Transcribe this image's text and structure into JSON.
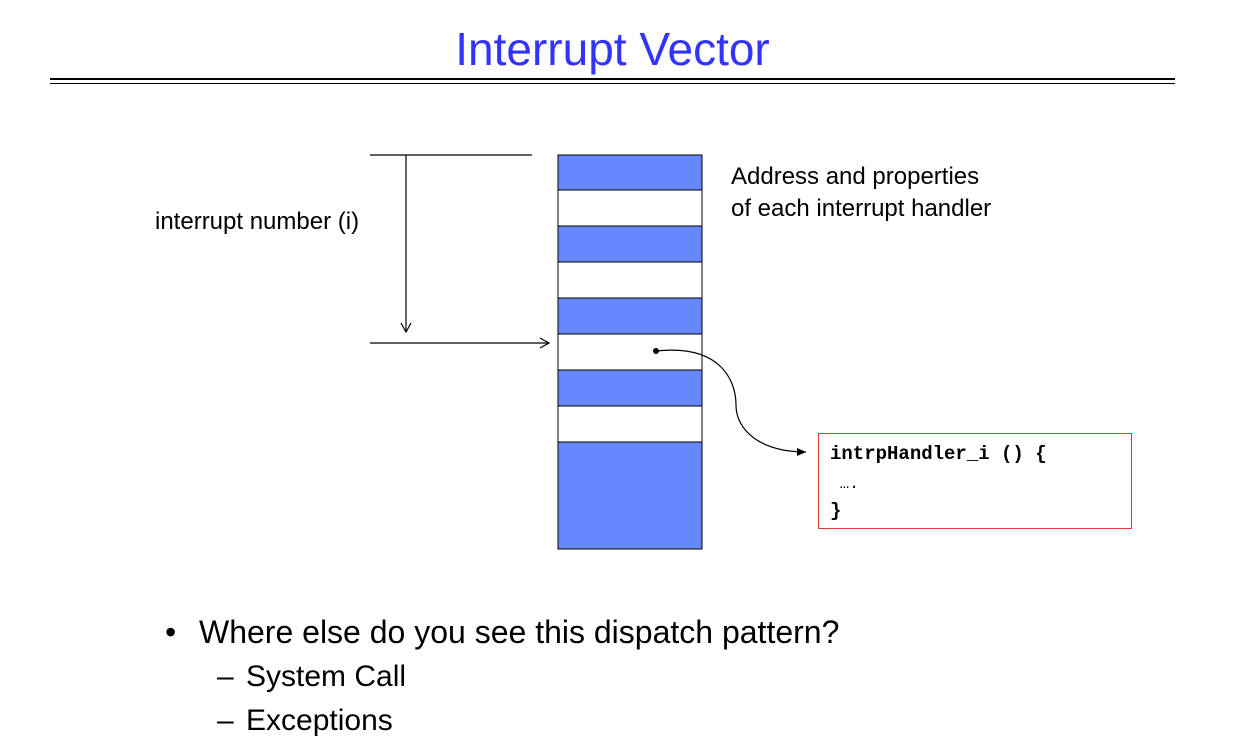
{
  "slide": {
    "title": "Interrupt Vector"
  },
  "diagram": {
    "interrupt_label": "interrupt number (i)",
    "table_label_line1": "Address and properties",
    "table_label_line2": "of each interrupt handler",
    "table_fill_color": "#6688ff",
    "highlight_row": 5,
    "code": {
      "line1": "intrpHandler_i () {",
      "line2": " ….",
      "line3": "}",
      "border_color": "#e03a3a"
    }
  },
  "bullets": {
    "main": "Where else do you see this dispatch pattern?",
    "sub": [
      "System Call",
      "Exceptions"
    ]
  }
}
